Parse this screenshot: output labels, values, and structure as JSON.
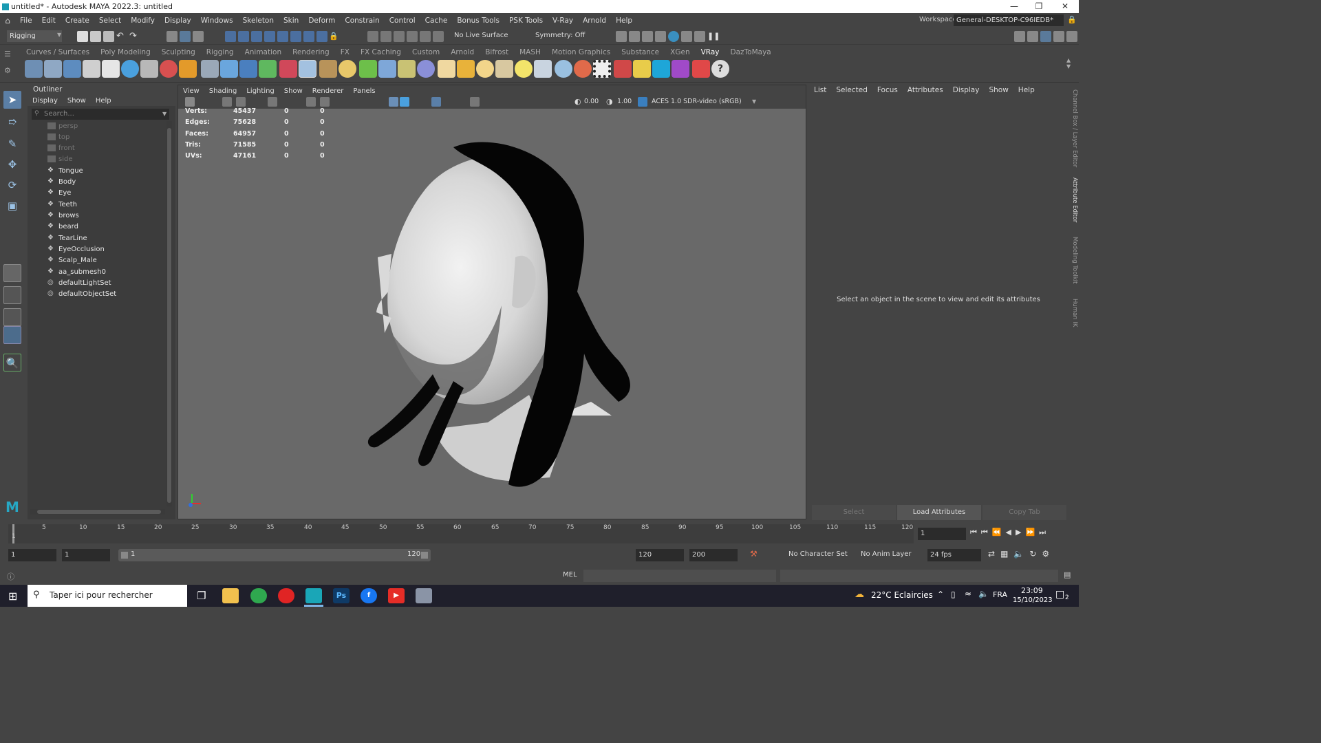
{
  "window": {
    "title": "untitled* - Autodesk MAYA 2022.3: untitled"
  },
  "menus": [
    "File",
    "Edit",
    "Create",
    "Select",
    "Modify",
    "Display",
    "Windows",
    "Skeleton",
    "Skin",
    "Deform",
    "Constrain",
    "Control",
    "Cache",
    "Bonus Tools",
    "PSK Tools",
    "V-Ray",
    "Arnold",
    "Help"
  ],
  "status": {
    "mode": "Rigging",
    "live_surface": "No Live Surface",
    "symmetry": "Symmetry: Off",
    "workspace_label": "Workspace:",
    "workspace": "General-DESKTOP-C96IEDB*"
  },
  "shelf_tabs": [
    "Curves / Surfaces",
    "Poly Modeling",
    "Sculpting",
    "Rigging",
    "Animation",
    "Rendering",
    "FX",
    "FX Caching",
    "Custom",
    "Arnold",
    "Bifrost",
    "MASH",
    "Motion Graphics",
    "Substance",
    "XGen",
    "VRay",
    "DazToMaya"
  ],
  "outliner": {
    "title": "Outliner",
    "menu": [
      "Display",
      "Show",
      "Help"
    ],
    "search_placeholder": "Search...",
    "items": [
      {
        "label": "persp",
        "dim": true
      },
      {
        "label": "top",
        "dim": true
      },
      {
        "label": "front",
        "dim": true
      },
      {
        "label": "side",
        "dim": true
      },
      {
        "label": "Tongue",
        "dim": false
      },
      {
        "label": "Body",
        "dim": false
      },
      {
        "label": "Eye",
        "dim": false
      },
      {
        "label": "Teeth",
        "dim": false
      },
      {
        "label": "brows",
        "dim": false
      },
      {
        "label": "beard",
        "dim": false
      },
      {
        "label": "TearLine",
        "dim": false
      },
      {
        "label": "EyeOcclusion",
        "dim": false
      },
      {
        "label": "Scalp_Male",
        "dim": false
      },
      {
        "label": "aa_submesh0",
        "dim": false
      },
      {
        "label": "defaultLightSet",
        "dim": false
      },
      {
        "label": "defaultObjectSet",
        "dim": false
      }
    ]
  },
  "viewport": {
    "menu": [
      "View",
      "Shading",
      "Lighting",
      "Show",
      "Renderer",
      "Panels"
    ],
    "exposure": "0.00",
    "gamma": "1.00",
    "color_space": "ACES 1.0 SDR-video (sRGB)",
    "hud": [
      {
        "label": "Verts:",
        "v1": "45437",
        "v2": "0",
        "v3": "0"
      },
      {
        "label": "Edges:",
        "v1": "75628",
        "v2": "0",
        "v3": "0"
      },
      {
        "label": "Faces:",
        "v1": "64957",
        "v2": "0",
        "v3": "0"
      },
      {
        "label": "Tris:",
        "v1": "71585",
        "v2": "0",
        "v3": "0"
      },
      {
        "label": "UVs:",
        "v1": "47161",
        "v2": "0",
        "v3": "0"
      }
    ]
  },
  "attribute_editor": {
    "menu": [
      "List",
      "Selected",
      "Focus",
      "Attributes",
      "Display",
      "Show",
      "Help"
    ],
    "message": "Select an object in the scene to view and edit its attributes",
    "buttons": [
      "Select",
      "Load Attributes",
      "Copy Tab"
    ]
  },
  "side_tabs": [
    "Channel Box / Layer Editor",
    "Attribute Editor",
    "Modeling Toolkit",
    "Human IK"
  ],
  "timeline": {
    "ticks": [
      "1",
      "5",
      "10",
      "15",
      "20",
      "25",
      "30",
      "35",
      "40",
      "45",
      "50",
      "55",
      "60",
      "65",
      "70",
      "75",
      "80",
      "85",
      "90",
      "95",
      "100",
      "105",
      "110",
      "115",
      "120"
    ],
    "current_frame": "1"
  },
  "range": {
    "start": "1",
    "anim_start": "1",
    "slider_start": "1",
    "slider_end": "120",
    "end": "120",
    "anim_end": "200",
    "character_set": "No Character Set",
    "anim_layer": "No Anim Layer",
    "fps": "24 fps"
  },
  "command": {
    "lang": "MEL"
  },
  "taskbar": {
    "search": "Taper ici pour rechercher",
    "weather": "22°C Eclaircies",
    "lang": "FRA",
    "time": "23:09",
    "date": "15/10/2023",
    "notifications": "2"
  }
}
